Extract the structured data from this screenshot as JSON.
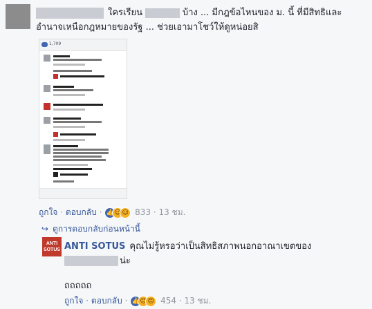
{
  "comment": {
    "text_part1": "ใครเรียน",
    "text_part2": "บ้าง ... มีกฎข้อไหนของ ม. นี้ ที่มีสิทธิและ",
    "text_line2": "อำนาจเหนือกฎหมายของรัฐ ... ช่วยเอามาโชว์ให้ดูหน่อยสิ",
    "like_label": "ถูกใจ",
    "reply_label": "ตอบกลับ",
    "reaction_count": "833",
    "time": "13 ชม."
  },
  "screenshot": {
    "reaction_count": "1,709"
  },
  "prior_replies_link": "ดูการตอบกลับก่อนหน้านี้",
  "reply": {
    "author": "ANTI SOTUS",
    "avatar_text": "ANTI SOTUS",
    "text_line1": "คุณไม่รู้หรอว่าเป็นสิทธิสภาพนอกอาณาเขตของ",
    "text_line1_end": "น่ะ",
    "text_line2": "ถถถถถ",
    "like_label": "ถูกใจ",
    "reply_label": "ตอบกลับ",
    "reaction_count": "454",
    "time": "13 ชม."
  },
  "icons": {
    "reply_arrow": "reply-arrow-icon",
    "like": "like-reaction-icon",
    "haha": "haha-reaction-icon",
    "wow": "wow-reaction-icon"
  },
  "colors": {
    "link": "#365899",
    "meta": "#90949c",
    "text": "#1d2129",
    "like_blue": "#4267b2",
    "anti_sotus_red": "#c0392b"
  }
}
